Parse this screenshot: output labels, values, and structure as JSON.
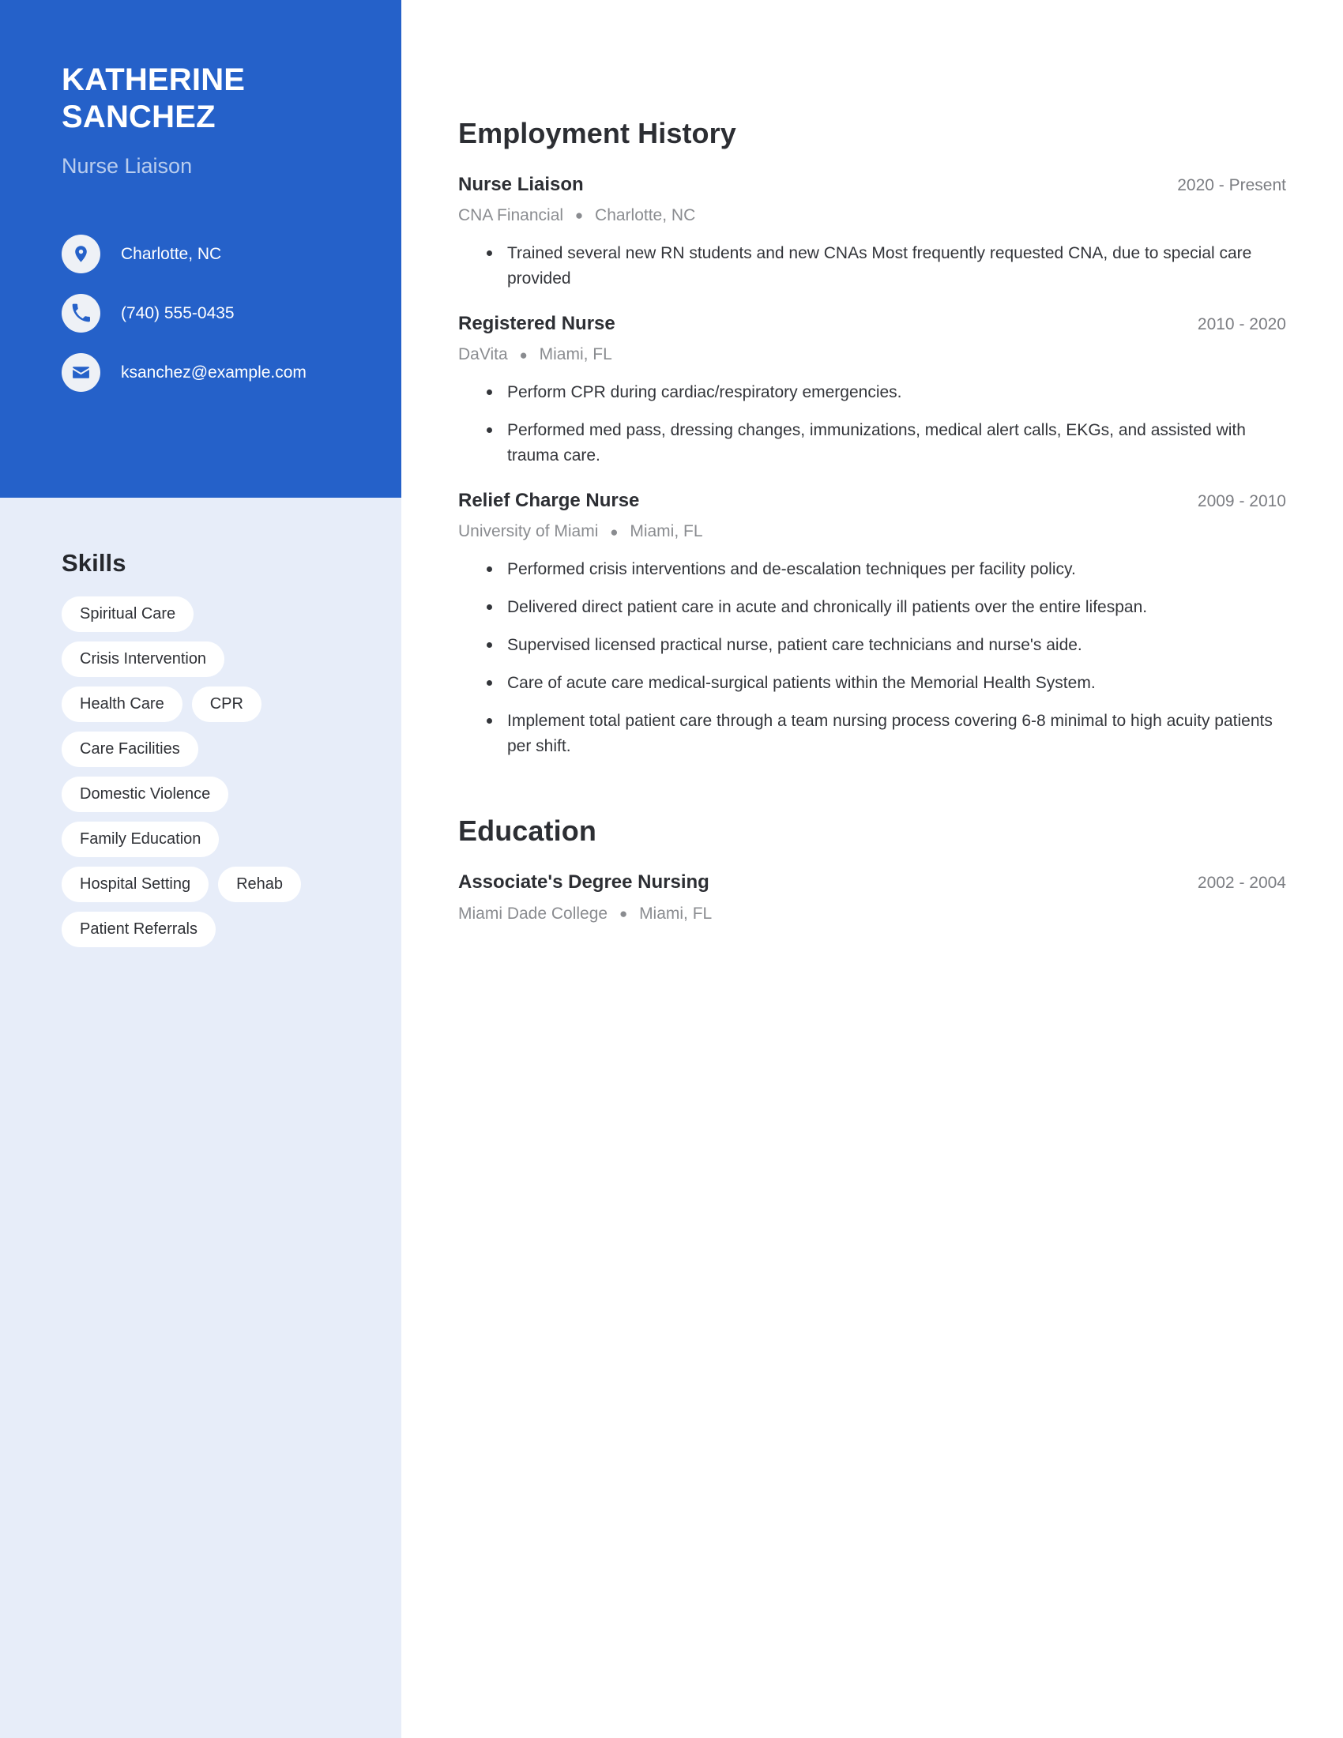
{
  "colors": {
    "header_blue": "#2561c9",
    "sidebar_light": "#e7edf9",
    "pill_white": "#ffffff",
    "job_title_muted": "#b9cdee",
    "body_text": "#33353a",
    "meta_text": "#8a8c90"
  },
  "header": {
    "first_name": "KATHERINE",
    "last_name": "SANCHEZ",
    "job_title": "Nurse Liaison"
  },
  "contact": [
    {
      "icon": "location-pin-icon",
      "value": "Charlotte, NC"
    },
    {
      "icon": "phone-icon",
      "value": "(740) 555-0435"
    },
    {
      "icon": "envelope-icon",
      "value": "ksanchez@example.com"
    }
  ],
  "skills": {
    "heading": "Skills",
    "rows": [
      [
        "Spiritual Care"
      ],
      [
        "Crisis Intervention"
      ],
      [
        "Health Care",
        "CPR"
      ],
      [
        "Care Facilities"
      ],
      [
        "Domestic Violence"
      ],
      [
        "Family Education"
      ],
      [
        "Hospital Setting",
        "Rehab"
      ],
      [
        "Patient Referrals"
      ]
    ]
  },
  "employment": {
    "heading": "Employment History",
    "entries": [
      {
        "role": "Nurse Liaison",
        "dates": "2020 - Present",
        "company": "CNA Financial",
        "location": "Charlotte, NC",
        "bullets": [
          "Trained several new RN students and new CNAs Most frequently requested CNA, due to special care provided"
        ]
      },
      {
        "role": "Registered Nurse",
        "dates": "2010 - 2020",
        "company": "DaVita",
        "location": "Miami, FL",
        "bullets": [
          "Perform CPR during cardiac/respiratory emergencies.",
          "Performed med pass, dressing changes, immunizations, medical alert calls, EKGs, and assisted with trauma care."
        ]
      },
      {
        "role": "Relief Charge Nurse",
        "dates": "2009 - 2010",
        "company": "University of Miami",
        "location": "Miami, FL",
        "bullets": [
          "Performed crisis interventions and de-escalation techniques per facility policy.",
          "Delivered direct patient care in acute and chronically ill patients over the entire lifespan.",
          "Supervised licensed practical nurse, patient care technicians and nurse's aide.",
          "Care of acute care medical-surgical patients within the Memorial Health System.",
          "Implement total patient care through a team nursing process covering 6-8 minimal to high acuity patients per shift."
        ]
      }
    ]
  },
  "education": {
    "heading": "Education",
    "entries": [
      {
        "degree": "Associate's Degree Nursing",
        "dates": "2002 - 2004",
        "school": "Miami Dade College",
        "location": "Miami, FL"
      }
    ]
  },
  "separator": "●"
}
